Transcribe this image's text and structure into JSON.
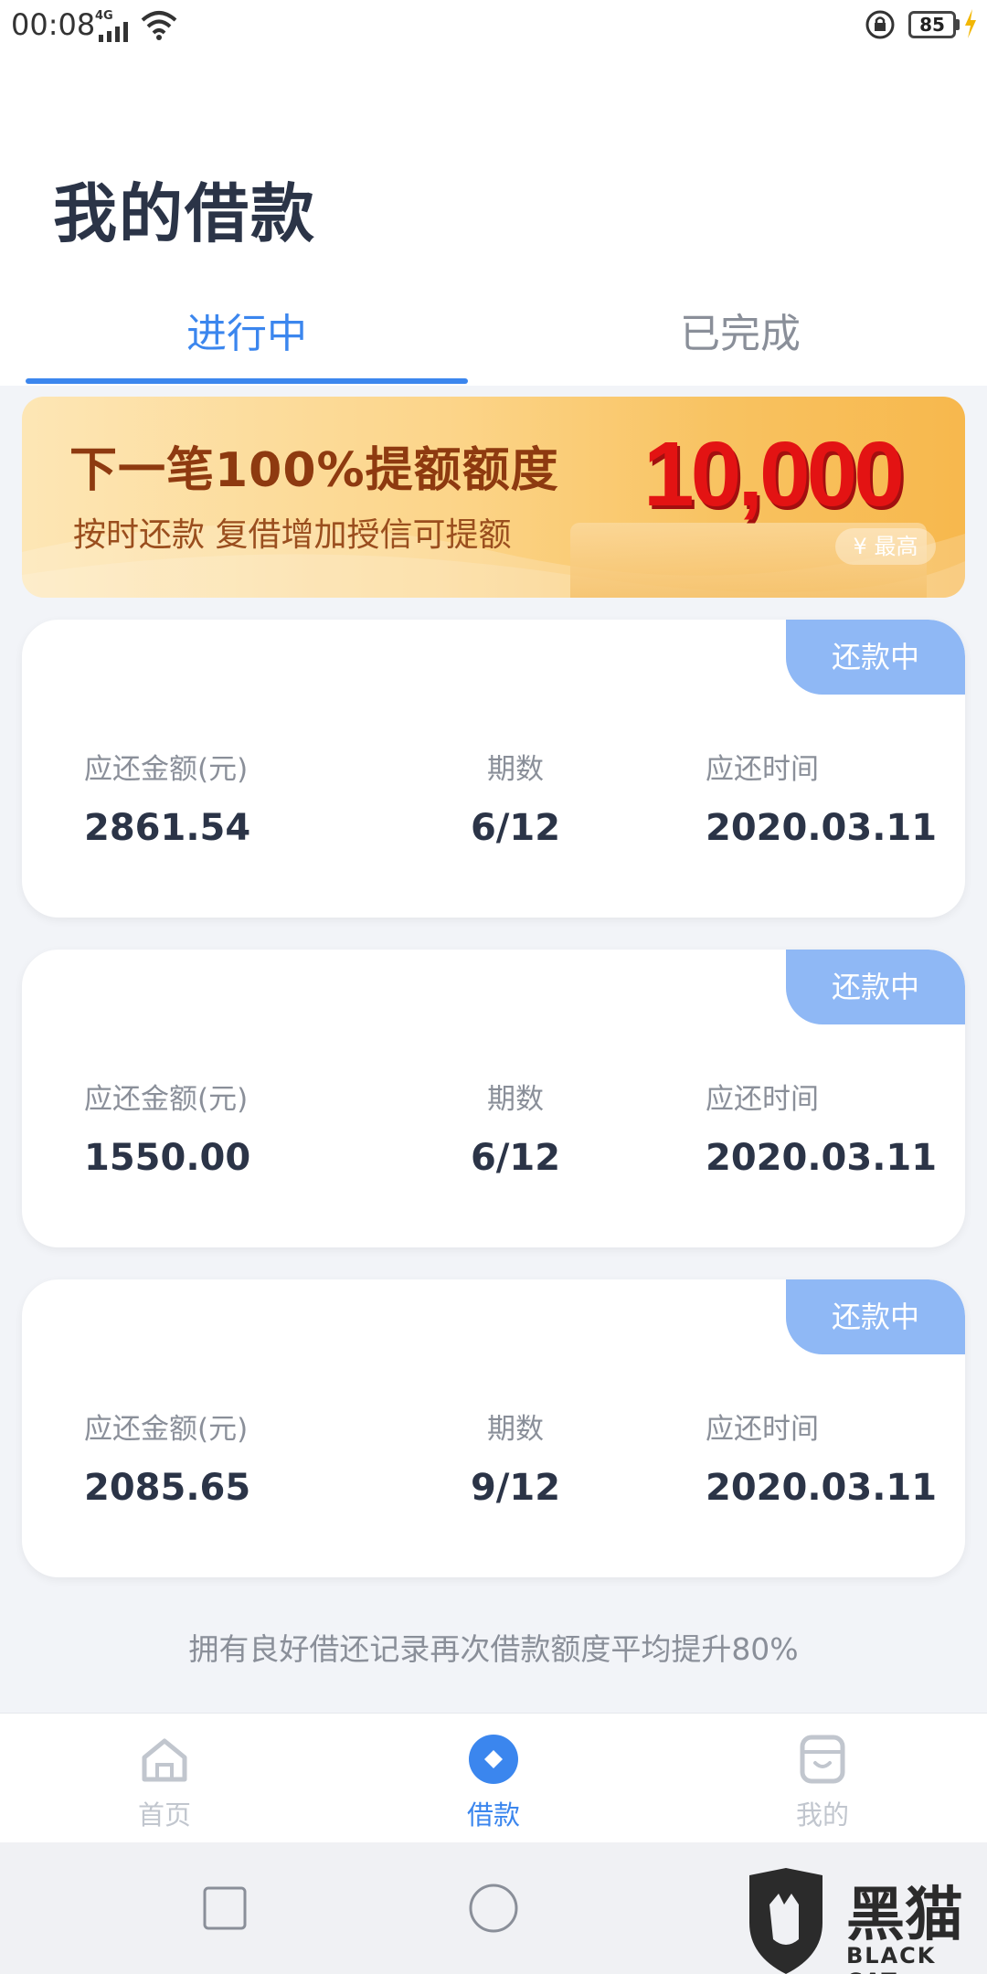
{
  "status_bar": {
    "time": "00:08",
    "network": "4G",
    "battery": "85"
  },
  "header": {
    "title": "我的借款",
    "tabs": [
      {
        "label": "进行中",
        "active": true
      },
      {
        "label": "已完成",
        "active": false
      }
    ]
  },
  "banner": {
    "headline": "下一笔100%提额额度",
    "subline": "按时还款  复借增加授信可提额",
    "amount": "10,000",
    "amount_caption": "¥ 最高"
  },
  "loans": [
    {
      "status": "还款中",
      "amount_label": "应还金额(元)",
      "amount": "2861.54",
      "period_label": "期数",
      "period": "6/12",
      "due_label": "应还时间",
      "due": "2020.03.11"
    },
    {
      "status": "还款中",
      "amount_label": "应还金额(元)",
      "amount": "1550.00",
      "period_label": "期数",
      "period": "6/12",
      "due_label": "应还时间",
      "due": "2020.03.11"
    },
    {
      "status": "还款中",
      "amount_label": "应还金额(元)",
      "amount": "2085.65",
      "period_label": "期数",
      "period": "9/12",
      "due_label": "应还时间",
      "due": "2020.03.11"
    }
  ],
  "footer_note": "拥有良好借还记录再次借款额度平均提升80%",
  "bottom_nav": {
    "items": [
      {
        "label": "首页",
        "icon": "home-icon"
      },
      {
        "label": "借款",
        "icon": "loan-icon",
        "active": true
      },
      {
        "label": "我的",
        "icon": "profile-icon"
      }
    ]
  },
  "watermark": {
    "text": "黑猫",
    "sub": "BLACK CAT"
  },
  "colors": {
    "accent": "#3b86ee",
    "badge": "#8fb8f5",
    "amount_red": "#e31313"
  }
}
